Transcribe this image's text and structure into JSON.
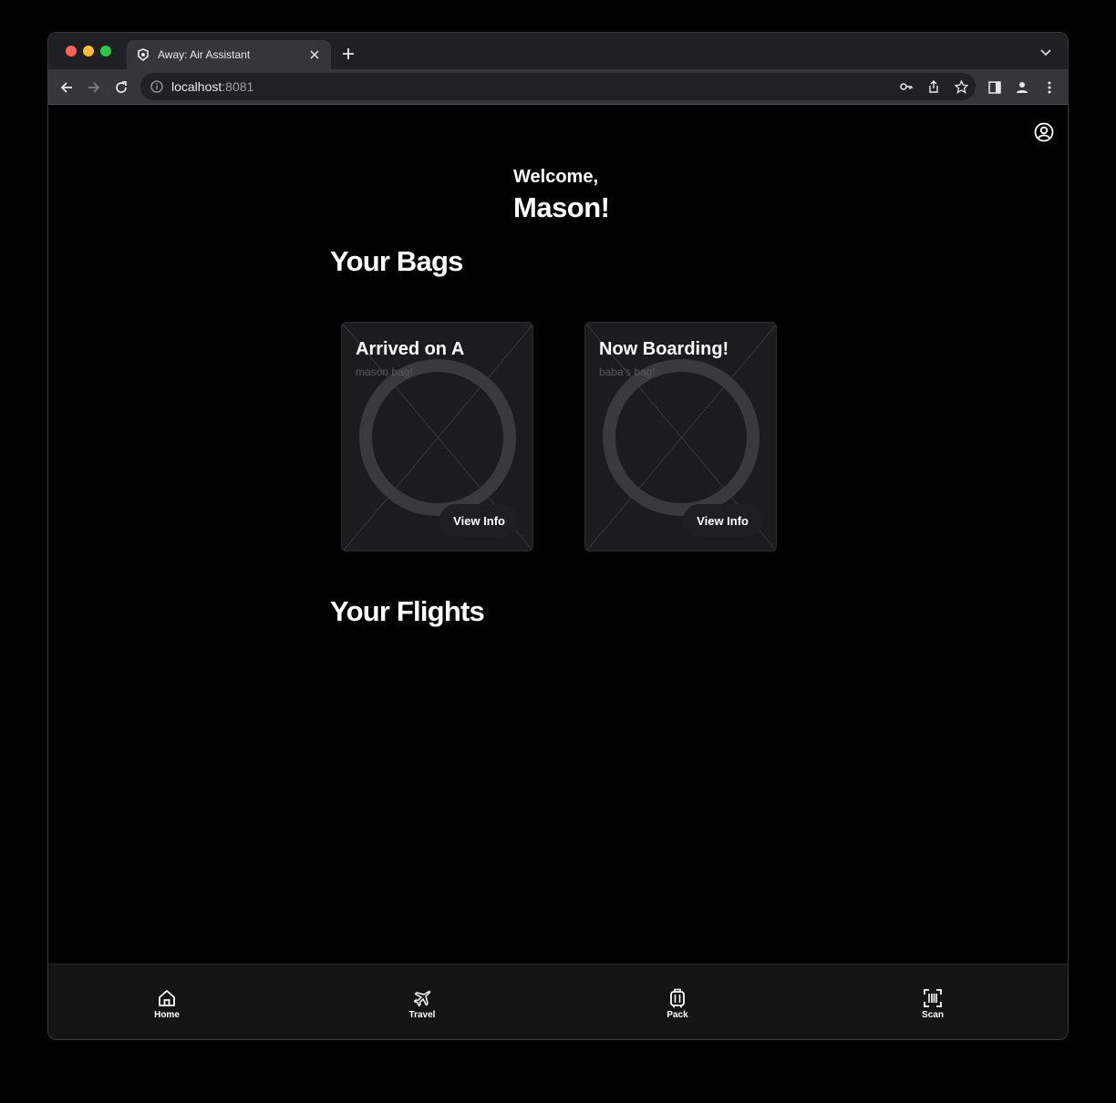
{
  "browser": {
    "tab_title": "Away: Air Assistant",
    "url_host": "localhost",
    "url_port": ":8081"
  },
  "greeting": {
    "welcome": "Welcome,",
    "name": "Mason!"
  },
  "bags_section": {
    "title": "Your Bags",
    "bags": [
      {
        "status": "Arrived on A",
        "name": "mason bag!",
        "button": "View Info"
      },
      {
        "status": "Now Boarding!",
        "name": "baba's bag!",
        "button": "View Info"
      }
    ]
  },
  "flights_section": {
    "title": "Your Flights"
  },
  "bottom_nav": {
    "items": [
      {
        "label": "Home",
        "icon": "home-icon"
      },
      {
        "label": "Travel",
        "icon": "airplane-icon"
      },
      {
        "label": "Pack",
        "icon": "luggage-icon"
      },
      {
        "label": "Scan",
        "icon": "barcode-scan-icon"
      }
    ]
  },
  "colors": {
    "background": "#000000",
    "card": "#1c1c1e",
    "chrome_tabstrip": "#1f2023",
    "chrome_toolbar": "#35363a"
  }
}
